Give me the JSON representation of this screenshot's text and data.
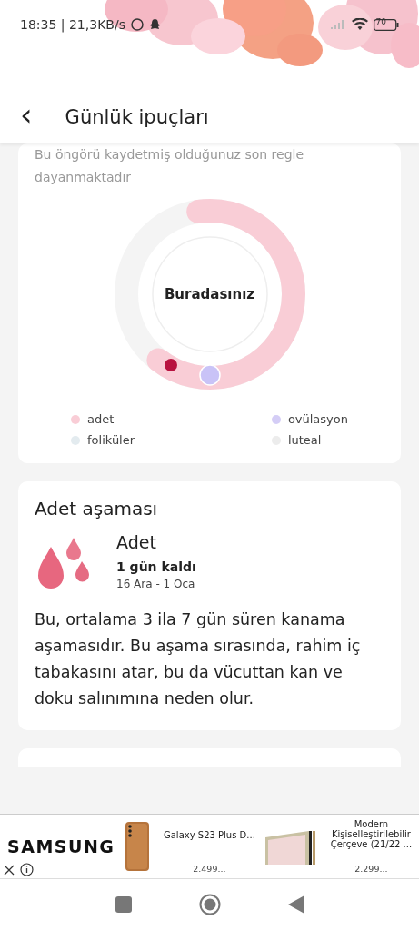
{
  "status_bar": {
    "time": "18:35 | 21,3KB/s",
    "battery": "70"
  },
  "header": {
    "back": "‹",
    "title": "Günlük ipuçları"
  },
  "cycle_card": {
    "note": "Bu öngörü kaydetmiş olduğunuz son regle dayanmaktadır",
    "center_label": "Buradasınız",
    "legend": [
      {
        "label": "adet",
        "color": "#f9cdd6"
      },
      {
        "label": "ovülasyon",
        "color": "#d4cdf6"
      },
      {
        "label": "foliküler",
        "color": "#e3ebef"
      },
      {
        "label": "luteal",
        "color": "#ececec"
      }
    ]
  },
  "phase_card": {
    "title": "Adet aşaması",
    "phase": "Adet",
    "remaining": "1 gün kaldı",
    "dates": "16 Ara - 1 Oca",
    "description": "Bu, ortalama 3 ila 7 gün süren kanama aşamasıdır. Bu aşama sırasında, rahim iç tabakasını atar, bu da vücuttan kan ve doku salınımına neden olur."
  },
  "ad": {
    "brand": "SAMSUNG",
    "products": [
      {
        "name": "Galaxy S23 Plus D...",
        "price": "2.499..."
      },
      {
        "name": "Modern Kişiselleştirilebilir Çerçeve (21/22 ...",
        "price": "2.299..."
      }
    ]
  }
}
